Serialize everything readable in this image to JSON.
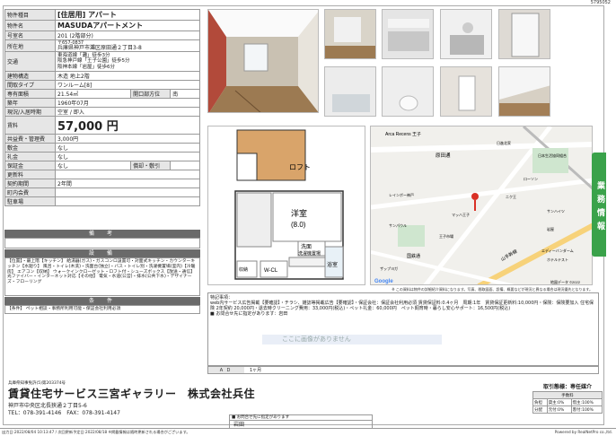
{
  "doc_id": "5795052",
  "info": {
    "type_label": "物件種目",
    "type_value": "[住居用] アパート",
    "name_label": "物件名",
    "name_value": "MASUDAアパートメント",
    "room_label": "号室名",
    "room_value": "201 (2階部分)",
    "addr_label": "所在地",
    "zip": "〒657-0837",
    "addr_value": "兵庫県神戸市灘区原田通２丁目3-8",
    "traffic_label": "交通",
    "traffic": [
      "東海道線「灘」徒歩3分",
      "阪急神戸線「王子公園」徒歩5分",
      "阪神本線「岩屋」徒歩6分"
    ],
    "structure_label": "建物構造",
    "structure_value": "木造 地上2階",
    "layout_label": "間取タイプ",
    "layout_value": "ワンルーム[8]",
    "area_label": "専有面積",
    "area_value": "21.54㎡",
    "opening_label": "開口部方位",
    "opening_value": "南",
    "built_label": "築年",
    "built_value": "1960年07月",
    "status_label": "現況/入居時期",
    "status_value": "空室 / 即入",
    "rent_label": "賃料",
    "rent_value": "57,000 円",
    "fee_label": "共益費・管理費",
    "fee_value": "3,000円",
    "shiki_label": "敷金",
    "shiki_value": "なし",
    "rei_label": "礼金",
    "rei_value": "なし",
    "hosho_label": "保証金",
    "hosho_value": "なし",
    "kyaku_label": "償却・敷引",
    "kyaku_value": "",
    "renew_label": "更新料",
    "renew_value": "",
    "term_label": "契約期間",
    "term_value": "2年間",
    "assoc_label": "町内会費",
    "assoc_value": "",
    "parking_label": "駐車場",
    "parking_value": ""
  },
  "sections": {
    "remarks_title": "備　考",
    "equip_title": "設　備",
    "equip_text": "【位置】・最上階【キッチン】 給湯器(ガス)・ガスコンロ設置可・対面式キッチン・カウンターキッチン【水廻り】 風呂・トイレ(木洗)・洗面台(独立)・バス・トイレ別・洗濯機置場(室内)【冷暖房】 エアコン【収納】 ウォークインクローゼット・ロフト付・シューズボックス【放送・通信】 光ファイバー・インターネット対応【その他】 電気・水道(公営)・排水(公共下水)・デザイナーズ・フローリング",
    "cond_title": "条　件",
    "cond_text": "【条件】 ペット相談・事務所利用可能・保証会社利用必須"
  },
  "plan": {
    "loft": "ロフト",
    "room": "洋室",
    "size": "(8.0)",
    "wash": "洗面",
    "laundry": "洗濯機置場",
    "bath": "浴室",
    "wcl": "W-CL",
    "storage": "収納",
    "kitchen": "キッチン"
  },
  "map": {
    "labels": [
      "Arca Recens 王子",
      "原田通",
      "日進北家",
      "日本生活協同組合",
      "レインボー神戸",
      "岩屋",
      "ニク王",
      "サンハイツ",
      "サンパウル",
      "王子市場",
      "国鉄通",
      "山手幹線",
      "ローソン",
      "エディーバンダーム",
      "ホテルテスト",
      "マッハ王子",
      "ザップヨガ"
    ],
    "brand": "Google",
    "copyright": "地図データ ©2022",
    "note": "※ この資料は物件の詳細紹介資料になります。写真、間取図面、設備、概要などが現況と異なる場合は現況優先となります。"
  },
  "remark": {
    "title": "特記事項：",
    "line1": "web内サービス広告掲載【要確認】・チラシ、雑誌等掲載広告【要確認】・保証会社：保証会社利用必須 賃貸保証料:0.4ヶ月　周期:1年　賃貸保証更新料:10,000円・保険：保険要加入 住宅保険 2年契約 20,000円・退去時クリーニング費用：33,000円(税込)・ペット礼金：60,000円　ペット飼育時・暮らし安心サポート：16,500円(税込)",
    "line2": "■ お問合せ先に指定があります：岩田",
    "placeholder": "ここに画像がありません"
  },
  "ad": {
    "label": "ＡＤ",
    "value": "1ヶ月"
  },
  "side_tab": "業務情報",
  "footer": {
    "license": "兵庫県知事免許(5)第203374号",
    "company": "賃貸住宅サービス三宮ギャラリー　株式会社兵住",
    "address": "神戸市中央区北長狭通２丁目5-6",
    "tel": "TEL：078-391-4146　FAX：078-391-4147",
    "contact_head": "■ お問合せ先に指定があります",
    "contact_name": "岩田"
  },
  "deal": {
    "title": "取引態様：専任媒介",
    "sub": "手数料",
    "rows": [
      [
        "負担",
        "貸主:0%",
        "借主:100%"
      ],
      [
        "分配",
        "元付:0%",
        "客付:100%"
      ]
    ]
  },
  "bottombar": {
    "left": "出力日:2022/08/04 10:13:47 / 次回更新予定日:2022/08/18 ※掲載情報は随時更新される場合がございます。",
    "right": "Powered by RealNetPro co.,ltd."
  },
  "colors": {
    "accent_green": "#3aa24a",
    "section_gray": "#6a6a6a",
    "label_bg": "#e6e6e6"
  }
}
